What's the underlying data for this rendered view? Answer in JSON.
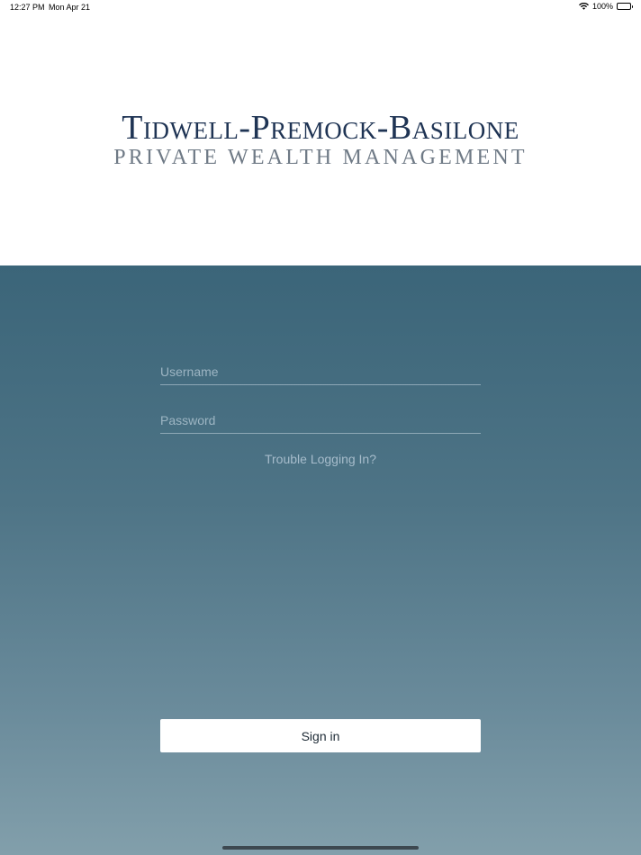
{
  "status_bar": {
    "time": "12:27 PM",
    "date": "Mon Apr 21",
    "battery": "100%",
    "icons": [
      "wifi-icon",
      "battery-icon"
    ]
  },
  "logo": {
    "line1": "Tidwell-Premock-Basilone",
    "line2": "PRIVATE WEALTH MANAGEMENT",
    "colors": {
      "line1": "#1f3454",
      "line2": "#6f7a86"
    }
  },
  "login": {
    "username_placeholder": "Username",
    "username_value": "",
    "password_placeholder": "Password",
    "password_value": "",
    "trouble_link": "Trouble Logging In?",
    "signin_label": "Sign in",
    "colors": {
      "gradient_top": "#3b6579",
      "gradient_bottom": "#829fab"
    }
  }
}
